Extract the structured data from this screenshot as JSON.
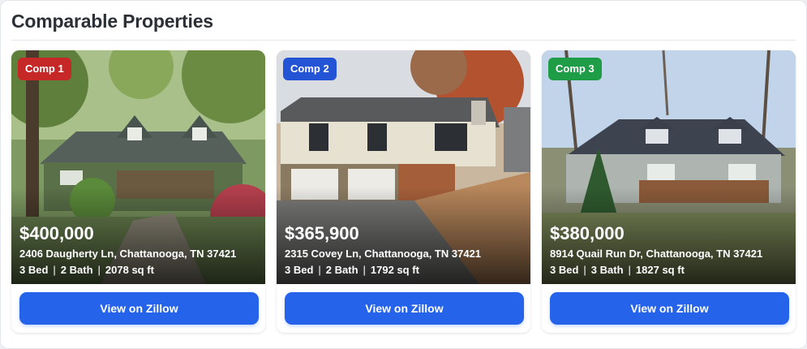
{
  "header": {
    "title": "Comparable Properties"
  },
  "comps": [
    {
      "badge": "Comp 1",
      "badge_color": "#c62828",
      "price": "$400,000",
      "address": "2406 Daugherty Ln, Chattanooga, TN 37421",
      "beds": "3 Bed",
      "baths": "2 Bath",
      "sqft": "2078 sq ft",
      "button_label": "View on Zillow"
    },
    {
      "badge": "Comp 2",
      "badge_color": "#2454d6",
      "price": "$365,900",
      "address": "2315 Covey Ln, Chattanooga, TN 37421",
      "beds": "3 Bed",
      "baths": "2 Bath",
      "sqft": "1792 sq ft",
      "button_label": "View on Zillow"
    },
    {
      "badge": "Comp 3",
      "badge_color": "#1f9d46",
      "price": "$380,000",
      "address": "8914 Quail Run Dr, Chattanooga, TN 37421",
      "beds": "3 Bed",
      "baths": "3 Bath",
      "sqft": "1827 sq ft",
      "button_label": "View on Zillow"
    }
  ],
  "separator": "|"
}
